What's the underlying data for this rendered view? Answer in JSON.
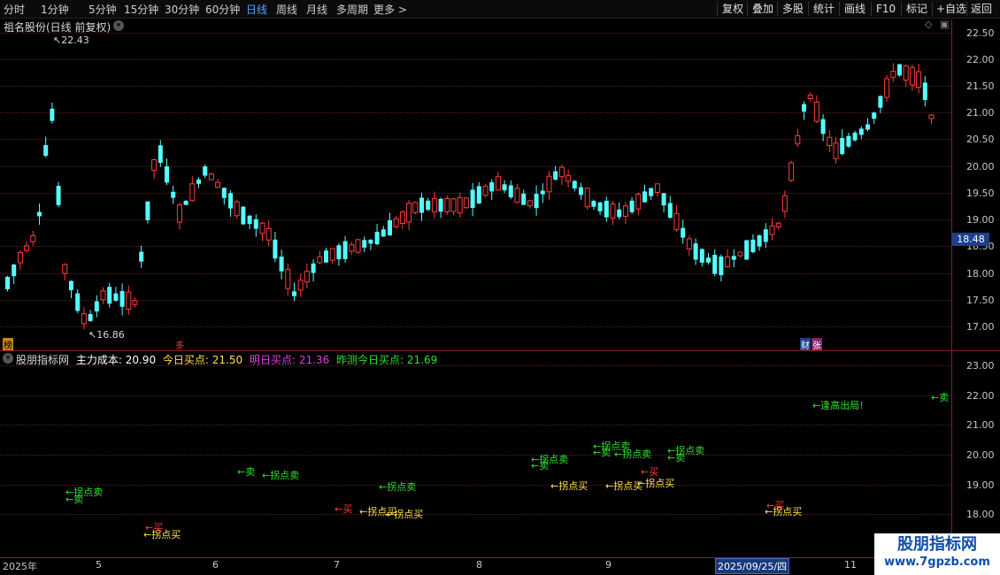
{
  "toolbar": {
    "periods": [
      "分时",
      "1分钟",
      "5分钟",
      "15分钟",
      "30分钟",
      "60分钟",
      "日线",
      "周线",
      "月线",
      "多周期",
      "更多 >"
    ],
    "active_period": "日线",
    "buttons": [
      "复权",
      "叠加",
      "多股",
      "统计",
      "画线",
      "F10",
      "标记",
      "+自选",
      "返回"
    ]
  },
  "main_chart": {
    "title": "祖名股份(日线 前复权)",
    "y_labels": [
      "22.50",
      "22.00",
      "21.50",
      "21.00",
      "20.50",
      "20.00",
      "19.50",
      "19.00",
      "18.50",
      "18.00",
      "17.50",
      "17.00"
    ],
    "current_price": "18.48",
    "high_mark": "22.43",
    "low_mark": "16.86",
    "left_badge": "榜",
    "mid_badge": "多",
    "right_badge": "财",
    "right_badge2": "张"
  },
  "indicator": {
    "name": "股朋指标网",
    "main_cost_label": "主力成本:",
    "main_cost_value": "20.90",
    "today_buy_label": "今日买点:",
    "today_buy_value": "21.50",
    "tomorrow_buy_label": "明日买点:",
    "tomorrow_buy_value": "21.36",
    "yesterday_label": "昨测今日买点:",
    "yesterday_value": "21.69",
    "y_labels": [
      "23.00",
      "22.00",
      "21.00",
      "20.00",
      "19.00",
      "18.00"
    ],
    "signals": [
      {
        "text": "←拐点卖",
        "color": "#2ee02e"
      },
      {
        "text": "←卖",
        "color": "#2ee02e"
      },
      {
        "text": "←拐点买",
        "color": "#ffe14a"
      },
      {
        "text": "←买",
        "color": "#ff3a3a"
      },
      {
        "text": "←卖",
        "color": "#2ee02e"
      },
      {
        "text": "←拐点卖",
        "color": "#2ee02e"
      },
      {
        "text": "←买",
        "color": "#ff3a3a"
      },
      {
        "text": "←拐点买",
        "color": "#ffe14a"
      },
      {
        "text": "←拐点买",
        "color": "#ffe14a"
      },
      {
        "text": "←拐点卖",
        "color": "#2ee02e"
      },
      {
        "text": "←拐点卖",
        "color": "#2ee02e"
      },
      {
        "text": "←卖",
        "color": "#2ee02e"
      },
      {
        "text": "←拐点买",
        "color": "#ffe14a"
      },
      {
        "text": "←拐点卖",
        "color": "#2ee02e"
      },
      {
        "text": "←卖",
        "color": "#2ee02e"
      },
      {
        "text": "←拐点卖",
        "color": "#2ee02e"
      },
      {
        "text": "←拐点买",
        "color": "#ffe14a"
      },
      {
        "text": "←买",
        "color": "#ff3a3a"
      },
      {
        "text": "←拐点买",
        "color": "#ffe14a"
      },
      {
        "text": "←拐点卖",
        "color": "#2ee02e"
      },
      {
        "text": "←卖",
        "color": "#2ee02e"
      },
      {
        "text": "←买",
        "color": "#ff3a3a"
      },
      {
        "text": "←拐点买",
        "color": "#ffe14a"
      },
      {
        "text": "←逢高出局!",
        "color": "#2ee02e"
      },
      {
        "text": "←卖",
        "color": "#2ee02e"
      }
    ]
  },
  "x_axis": {
    "labels": [
      "2025年",
      "5",
      "6",
      "7",
      "8",
      "9",
      "11"
    ],
    "selected_date": "2025/09/25/四"
  },
  "watermark": {
    "title": "股朋指标网",
    "url": "www.7gpzb.com"
  },
  "colors": {
    "up": "#ff3c3c",
    "down": "#54ffff",
    "grid": "#5a1e1e",
    "accent": "#4fa7ff"
  }
}
